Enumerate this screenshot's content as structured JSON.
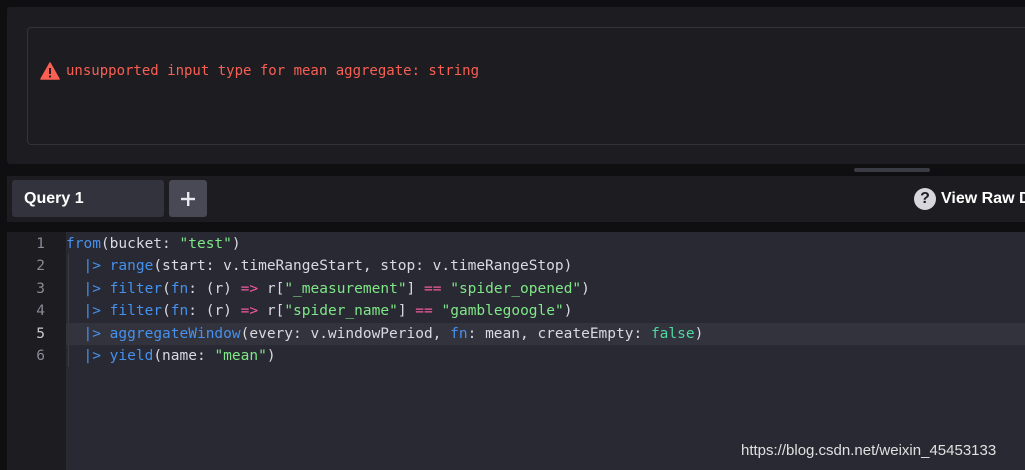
{
  "error": {
    "icon": "warning-icon",
    "message": "unsupported input type for mean aggregate: string",
    "color": "#f95f53"
  },
  "tabs": {
    "active_label": "Query 1",
    "add_icon": "plus-icon",
    "view_raw_label": "View Raw D",
    "help_icon": "question-icon",
    "help_glyph": "?"
  },
  "editor": {
    "line_numbers": [
      "1",
      "2",
      "3",
      "4",
      "5",
      "6"
    ],
    "active_line": 5,
    "lines": [
      [
        {
          "t": "fn",
          "v": "from"
        },
        {
          "t": "plain",
          "v": "(bucket: "
        },
        {
          "t": "str",
          "v": "\"test\""
        },
        {
          "t": "plain",
          "v": ")"
        }
      ],
      [
        {
          "t": "plain",
          "v": "  "
        },
        {
          "t": "pipe",
          "v": "|>"
        },
        {
          "t": "plain",
          "v": " "
        },
        {
          "t": "fn",
          "v": "range"
        },
        {
          "t": "plain",
          "v": "(start: v.timeRangeStart, stop: v.timeRangeStop)"
        }
      ],
      [
        {
          "t": "plain",
          "v": "  "
        },
        {
          "t": "pipe",
          "v": "|>"
        },
        {
          "t": "plain",
          "v": " "
        },
        {
          "t": "fn",
          "v": "filter"
        },
        {
          "t": "plain",
          "v": "("
        },
        {
          "t": "fn",
          "v": "fn"
        },
        {
          "t": "plain",
          "v": ": (r) "
        },
        {
          "t": "op",
          "v": "=>"
        },
        {
          "t": "plain",
          "v": " r["
        },
        {
          "t": "str",
          "v": "\"_measurement\""
        },
        {
          "t": "plain",
          "v": "] "
        },
        {
          "t": "op",
          "v": "=="
        },
        {
          "t": "plain",
          "v": " "
        },
        {
          "t": "str",
          "v": "\"spider_opened\""
        },
        {
          "t": "plain",
          "v": ")"
        }
      ],
      [
        {
          "t": "plain",
          "v": "  "
        },
        {
          "t": "pipe",
          "v": "|>"
        },
        {
          "t": "plain",
          "v": " "
        },
        {
          "t": "fn",
          "v": "filter"
        },
        {
          "t": "plain",
          "v": "("
        },
        {
          "t": "fn",
          "v": "fn"
        },
        {
          "t": "plain",
          "v": ": (r) "
        },
        {
          "t": "op",
          "v": "=>"
        },
        {
          "t": "plain",
          "v": " r["
        },
        {
          "t": "str",
          "v": "\"spider_name\""
        },
        {
          "t": "plain",
          "v": "] "
        },
        {
          "t": "op",
          "v": "=="
        },
        {
          "t": "plain",
          "v": " "
        },
        {
          "t": "str",
          "v": "\"gamblegoogle\""
        },
        {
          "t": "plain",
          "v": ")"
        }
      ],
      [
        {
          "t": "plain",
          "v": "  "
        },
        {
          "t": "pipe",
          "v": "|>"
        },
        {
          "t": "plain",
          "v": " "
        },
        {
          "t": "fn",
          "v": "aggregateWindow"
        },
        {
          "t": "plain",
          "v": "(every: v.windowPeriod, "
        },
        {
          "t": "fn",
          "v": "fn"
        },
        {
          "t": "plain",
          "v": ": mean, createEmpty: "
        },
        {
          "t": "bool",
          "v": "false"
        },
        {
          "t": "plain",
          "v": ")"
        }
      ],
      [
        {
          "t": "plain",
          "v": "  "
        },
        {
          "t": "pipe",
          "v": "|>"
        },
        {
          "t": "plain",
          "v": " "
        },
        {
          "t": "fn",
          "v": "yield"
        },
        {
          "t": "plain",
          "v": "(name: "
        },
        {
          "t": "str",
          "v": "\"mean\""
        },
        {
          "t": "plain",
          "v": ")"
        }
      ]
    ]
  },
  "watermark": "https://blog.csdn.net/weixin_45453133"
}
